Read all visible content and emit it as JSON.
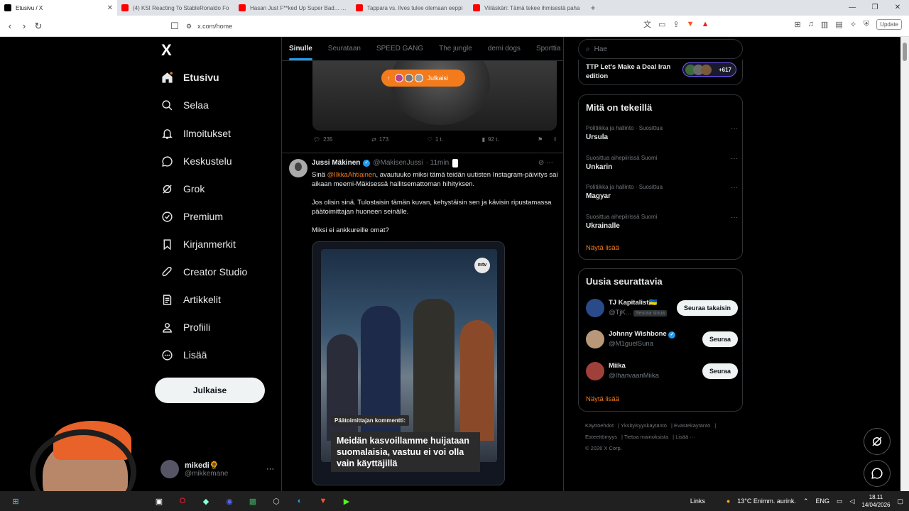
{
  "browser": {
    "tabs": [
      {
        "title": "Etusivu / X",
        "color": "#000000",
        "active": true
      },
      {
        "title": "(4) KSI Reacting To StableRonaldo Fo",
        "color": "#ff0000",
        "active": false
      },
      {
        "title": "Hasan Just F**ked Up Super Bad... - Y",
        "color": "#ff0000",
        "active": false
      },
      {
        "title": "Tappara vs. Ilves tulee olemaan eeppi",
        "color": "#ff0000",
        "active": false
      },
      {
        "title": "Viiläskäri: Tämä tekee ihmisestä paha",
        "color": "#ff0000",
        "active": false
      }
    ],
    "url": "x.com/home",
    "update_label": "Update"
  },
  "sidebar": {
    "logo": "X",
    "items": [
      {
        "label": "Etusivu",
        "icon": "home-icon"
      },
      {
        "label": "Selaa",
        "icon": "search-icon"
      },
      {
        "label": "Ilmoitukset",
        "icon": "bell-icon"
      },
      {
        "label": "Keskustelu",
        "icon": "chat-icon"
      },
      {
        "label": "Grok",
        "icon": "grok-icon"
      },
      {
        "label": "Premium",
        "icon": "premium-icon"
      },
      {
        "label": "Kirjanmerkit",
        "icon": "bookmark-icon"
      },
      {
        "label": "Creator Studio",
        "icon": "rocket-icon"
      },
      {
        "label": "Artikkelit",
        "icon": "article-icon"
      },
      {
        "label": "Profiili",
        "icon": "profile-icon"
      },
      {
        "label": "Lisää",
        "icon": "more-icon"
      }
    ],
    "post_button": "Julkaise",
    "account": {
      "name": "mikedi🌻",
      "handle": "@mikkemane"
    }
  },
  "feed": {
    "tabs": [
      "Sinulle",
      "Seurataan",
      "SPEED GANG",
      "The jungle",
      "demi dogs",
      "Sporttia Sa"
    ],
    "new_posts_pill": "Julkaisi",
    "prev_post_actions": {
      "replies": "235",
      "reposts": "173",
      "likes": "1 t.",
      "views": "92 t."
    },
    "tweet": {
      "name": "Jussi Mäkinen",
      "handle": "@MakisenJussi",
      "time": "· 11min",
      "body_pre": "Sinä ",
      "mention": "@IlkkaAhtiainen",
      "body_post": ", avautuuko miksi tämä teidän uutisten Instagram-päivitys sai aikaan meemi-Mäkisessä hallitsemattoman hihityksen.",
      "para2": "Jos olisin sinä. Tulostaisin tämän kuvan, kehystäisin sen ja kävisin ripustamassa päätoimittajan huoneen seinälle.",
      "para3": "Miksi ei ankkureille omat?",
      "media_label": "Päätoimittajan kommentti:",
      "media_caption": "Meidän kasvoillamme huijataan suomalaisia, vastuu ei voi olla vain käyttäjillä",
      "media_logo": "mtv"
    }
  },
  "right": {
    "search_placeholder": "Hae",
    "live": {
      "title": "TTP Let's Make a Deal Iran edition",
      "count": "+617"
    },
    "trends_title": "Mitä on tekeillä",
    "trends": [
      {
        "meta": "Politiikka ja hallinto · Suosittua",
        "name": "Ursula"
      },
      {
        "meta": "Suosittua aihepiirissä Suomi",
        "name": "Unkarin"
      },
      {
        "meta": "Politiikka ja hallinto · Suosittua",
        "name": "Magyar"
      },
      {
        "meta": "Suosittua aihepiirissä Suomi",
        "name": "Ukrainalle"
      }
    ],
    "show_more": "Näytä lisää",
    "followers_title": "Uusia seurattavia",
    "followers": [
      {
        "name": "TJ Kapitalist🇺🇦",
        "handle": "@TjK...",
        "badge": "Seuraa sinua",
        "button": "Seuraa takaisin"
      },
      {
        "name": "Johnny Wishbone",
        "handle": "@M1guelSuna",
        "badge": "",
        "button": "Seuraa"
      },
      {
        "name": "Miika",
        "handle": "@IhanvaanMiika",
        "badge": "",
        "button": "Seuraa"
      }
    ],
    "footer": [
      "Käyttöehdot",
      "Yksityisyyskäytäntö",
      "Evästekäytäntö",
      "Esteettömyys",
      "Tietoa mainoksista",
      "Lisää ···",
      "© 2026 X Corp."
    ]
  },
  "taskbar": {
    "links": "Links",
    "weather": "13°C Enimm. aurink.",
    "lang": "ENG",
    "time": "18.11",
    "date": "14/04/2026"
  }
}
